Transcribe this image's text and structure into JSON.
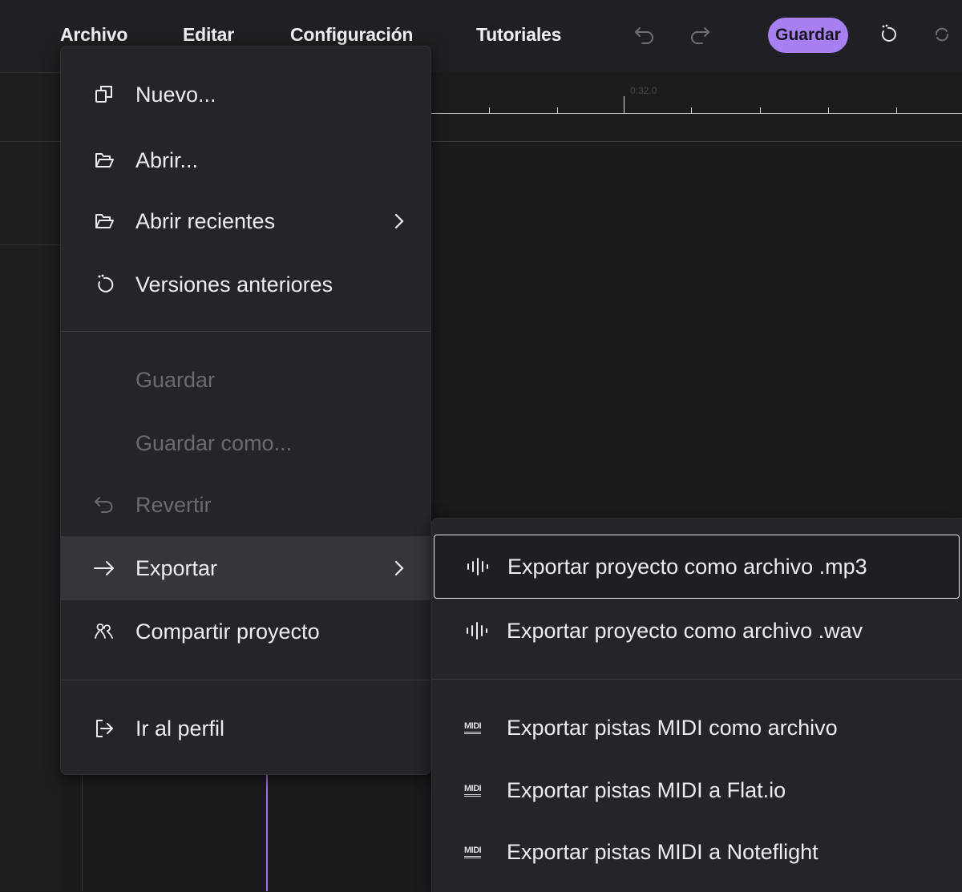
{
  "menubar": {
    "archivo": "Archivo",
    "editar": "Editar",
    "configuracion": "Configuración",
    "tutoriales": "Tutoriales",
    "save_button": "Guardar"
  },
  "ruler": {
    "time_label": "0:32.0"
  },
  "file_menu": {
    "items": [
      {
        "label": "Nuevo...",
        "icon": "new-copy-icon"
      },
      {
        "label": "Abrir...",
        "icon": "folder-open-icon"
      },
      {
        "label": "Abrir recientes",
        "icon": "folder-open-icon",
        "submenu": true
      },
      {
        "label": "Versiones anteriores",
        "icon": "history-icon"
      },
      {
        "label": "Guardar",
        "disabled": true
      },
      {
        "label": "Guardar como...",
        "disabled": true
      },
      {
        "label": "Revertir",
        "icon": "undo-icon",
        "disabled": true
      },
      {
        "label": "Exportar",
        "icon": "arrow-right-icon",
        "submenu": true,
        "active": true
      },
      {
        "label": "Compartir proyecto",
        "icon": "share-users-icon"
      },
      {
        "label": "Ir al perfil",
        "icon": "profile-exit-icon"
      }
    ]
  },
  "export_submenu": {
    "items": [
      {
        "label": "Exportar proyecto como archivo .mp3",
        "icon": "audio-wave-icon",
        "focused": true
      },
      {
        "label": "Exportar proyecto como archivo .wav",
        "icon": "audio-wave-icon"
      },
      {
        "label": "Exportar pistas MIDI como archivo",
        "icon": "midi-icon",
        "icon_text": "MIDI"
      },
      {
        "label": "Exportar pistas MIDI a Flat.io",
        "icon": "midi-icon",
        "icon_text": "MIDI"
      },
      {
        "label": "Exportar pistas MIDI a Noteflight",
        "icon": "midi-icon",
        "icon_text": "MIDI"
      }
    ]
  },
  "colors": {
    "accent": "#a87ff1",
    "background": "#1b1b1e",
    "menu_bg": "#252529",
    "active_row": "#35353b",
    "disabled_text": "#6a6a72"
  }
}
